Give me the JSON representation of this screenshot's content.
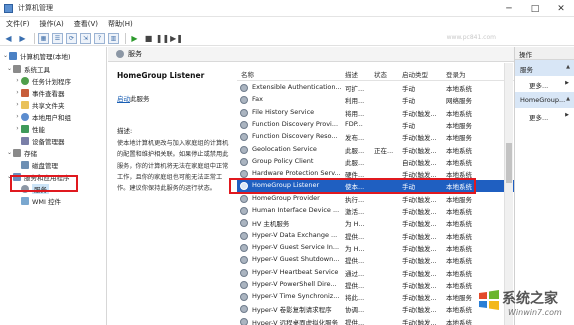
{
  "window": {
    "title": "计算机管理",
    "min_glyph": "─",
    "max_glyph": "□",
    "close_glyph": "✕"
  },
  "menu": [
    "文件(F)",
    "操作(A)",
    "查看(V)",
    "帮助(H)"
  ],
  "toolbar": {
    "back": "◀",
    "forward": "▶",
    "play": "▶",
    "stop": "■",
    "pause": "❚❚",
    "restart": "▶❚"
  },
  "watermark": "www.pc841.com",
  "tree": {
    "root": "计算机管理(本地)",
    "system_tools": "系统工具",
    "task_scheduler": "任务计划程序",
    "event_viewer": "事件查看器",
    "shared_folders": "共享文件夹",
    "local_users": "本地用户和组",
    "performance": "性能",
    "device_manager": "设备管理器",
    "storage": "存储",
    "disk_management": "磁盘管理",
    "services_and_apps": "服务和应用程序",
    "services": "服务",
    "wmi": "WMI 控件"
  },
  "content": {
    "title": "服务",
    "selected_service": "HomeGroup Listener",
    "action_link": "启动",
    "action_suffix": "此服务",
    "description_label": "描述:",
    "description_text": "使本地计算机更改与加入家庭组的计算机的配置和维护相关联。如果停止或禁用此服务，你的计算机将无法在家庭组中正常工作，且你的家庭组也可能无法正常工作。建议你保持此服务的运行状态。"
  },
  "services_table": {
    "headers": {
      "name": "名称",
      "description": "描述",
      "status": "状态",
      "startup": "启动类型",
      "logon": "登录为"
    },
    "rows": [
      {
        "name": "Extensible Authentication...",
        "description": "可扩...",
        "status": "",
        "startup": "手动",
        "logon": "本地系统"
      },
      {
        "name": "Fax",
        "description": "利用...",
        "status": "",
        "startup": "手动",
        "logon": "网络服务"
      },
      {
        "name": "File History Service",
        "description": "将用...",
        "status": "",
        "startup": "手动(触发...",
        "logon": "本地系统"
      },
      {
        "name": "Function Discovery Provi...",
        "description": "FDP...",
        "status": "",
        "startup": "手动",
        "logon": "本地服务"
      },
      {
        "name": "Function Discovery Reso...",
        "description": "发布...",
        "status": "",
        "startup": "手动(触发...",
        "logon": "本地服务"
      },
      {
        "name": "Geolocation Service",
        "description": "此服...",
        "status": "正在...",
        "startup": "手动(触发...",
        "logon": "本地系统"
      },
      {
        "name": "Group Policy Client",
        "description": "此服...",
        "status": "",
        "startup": "自动(触发...",
        "logon": "本地系统"
      },
      {
        "name": "Hardware Protection Serv...",
        "description": "硬件...",
        "status": "",
        "startup": "手动(触发...",
        "logon": "本地系统"
      },
      {
        "name": "HomeGroup Listener",
        "description": "使本...",
        "status": "",
        "startup": "手动",
        "logon": "本地系统"
      },
      {
        "name": "HomeGroup Provider",
        "description": "执行...",
        "status": "",
        "startup": "手动(触发...",
        "logon": "本地服务"
      },
      {
        "name": "Human Interface Device ...",
        "description": "激活...",
        "status": "",
        "startup": "手动(触发...",
        "logon": "本地系统"
      },
      {
        "name": "HV 主机服务",
        "description": "为 H...",
        "status": "",
        "startup": "手动(触发...",
        "logon": "本地系统"
      },
      {
        "name": "Hyper-V Data Exchange ...",
        "description": "提供...",
        "status": "",
        "startup": "手动(触发...",
        "logon": "本地系统"
      },
      {
        "name": "Hyper-V Guest Service In...",
        "description": "为 H...",
        "status": "",
        "startup": "手动(触发...",
        "logon": "本地系统"
      },
      {
        "name": "Hyper-V Guest Shutdown...",
        "description": "提供...",
        "status": "",
        "startup": "手动(触发...",
        "logon": "本地系统"
      },
      {
        "name": "Hyper-V Heartbeat Service",
        "description": "通过...",
        "status": "",
        "startup": "手动(触发...",
        "logon": "本地系统"
      },
      {
        "name": "Hyper-V PowerShell Dire...",
        "description": "提供...",
        "status": "",
        "startup": "手动(触发...",
        "logon": "本地系统"
      },
      {
        "name": "Hyper-V Time Synchroniz...",
        "description": "将此...",
        "status": "",
        "startup": "手动(触发...",
        "logon": "本地服务"
      },
      {
        "name": "Hyper-V 卷影复制请求程序",
        "description": "协调...",
        "status": "",
        "startup": "手动(触发...",
        "logon": "本地系统"
      },
      {
        "name": "Hyper-V 远程桌面虚拟化服务",
        "description": "提供...",
        "status": "",
        "startup": "手动(触发...",
        "logon": "本地系统"
      }
    ]
  },
  "actions": {
    "header": "操作",
    "section1": "服务",
    "more1": "更多...",
    "section2": "HomeGroup...",
    "more2": "更多..."
  },
  "logo": {
    "text": "系统之家",
    "url": "Winwin7.com"
  },
  "colors": {
    "highlight": "#1f5fc1",
    "annotation_red": "#e0191f",
    "link": "#1a5fb4"
  }
}
